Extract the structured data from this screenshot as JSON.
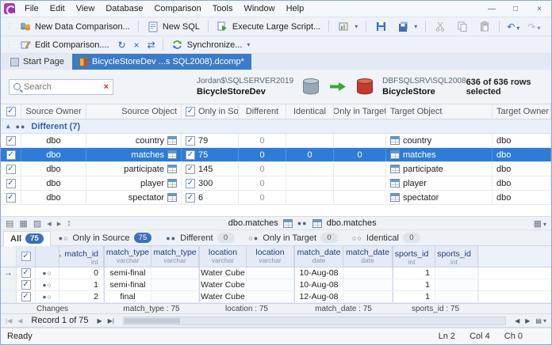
{
  "titlebar": {
    "menus": [
      "File",
      "Edit",
      "View",
      "Database",
      "Comparison",
      "Tools",
      "Window",
      "Help"
    ]
  },
  "toolbar_main": {
    "new_data_comparison": "New Data Comparison...",
    "new_sql": "New SQL",
    "execute_large_script": "Execute Large Script..."
  },
  "toolbar_compare": {
    "edit_comparison": "Edit Comparison....",
    "synchronize": "Synchronize..."
  },
  "doc_tabs": [
    {
      "label": "Start Page"
    },
    {
      "label": "BicycleStoreDev ...s SQL2008).dcomp*"
    }
  ],
  "comparison_header": {
    "search": {
      "placeholder": "Search"
    },
    "source": {
      "server": "Jordan$\\SQLSERVER2019",
      "database": "BicycleStoreDev"
    },
    "target": {
      "server": "DBFSQLSRV\\SQL2008",
      "database": "BicycleStore"
    },
    "selection_summary": "636 of 636 rows selected"
  },
  "upper_grid": {
    "headers": {
      "source_owner": "Source Owner",
      "source_object": "Source Object",
      "only_in_source": "Only in Source",
      "different": "Different",
      "identical": "Identical",
      "only_in_target": "Only in Target",
      "target_object": "Target Object",
      "target_owner": "Target Owner"
    },
    "group": {
      "glyph": "●●",
      "label": "Different (7)"
    },
    "rows": [
      {
        "source_owner": "dbo",
        "source_object": "country",
        "only_in_source": "79",
        "different": "0",
        "identical": "",
        "only_in_target": "",
        "target_object": "country",
        "target_owner": "dbo"
      },
      {
        "source_owner": "dbo",
        "source_object": "matches",
        "only_in_source": "75",
        "different": "0",
        "identical": "0",
        "only_in_target": "0",
        "target_object": "matches",
        "target_owner": "dbo"
      },
      {
        "source_owner": "dbo",
        "source_object": "participate",
        "only_in_source": "145",
        "different": "0",
        "identical": "",
        "only_in_target": "",
        "target_object": "participate",
        "target_owner": "dbo"
      },
      {
        "source_owner": "dbo",
        "source_object": "player",
        "only_in_source": "300",
        "different": "0",
        "identical": "",
        "only_in_target": "",
        "target_object": "player",
        "target_owner": "dbo"
      },
      {
        "source_owner": "dbo",
        "source_object": "spectator",
        "only_in_source": "6",
        "different": "0",
        "identical": "",
        "only_in_target": "",
        "target_object": "spectator",
        "target_owner": "dbo"
      }
    ]
  },
  "detail": {
    "mapping": {
      "source": "dbo.matches",
      "glyph": "●●",
      "target": "dbo.matches"
    },
    "tabs": [
      {
        "glyph": "",
        "label": "All",
        "badge": "75"
      },
      {
        "glyph": "●○",
        "label": "Only in Source",
        "badge": "75"
      },
      {
        "glyph": "●●",
        "label": "Different",
        "badge": "0"
      },
      {
        "glyph": "○●",
        "label": "Only in Target",
        "badge": "0"
      },
      {
        "glyph": "○○",
        "label": "Identical",
        "badge": "0"
      }
    ],
    "grid": {
      "columns": [
        {
          "name": "match_id",
          "type": "int"
        },
        {
          "name": "match_type",
          "type": "varchar"
        },
        {
          "name": "match_type",
          "type": "varchar"
        },
        {
          "name": "location",
          "type": "varchar"
        },
        {
          "name": "location",
          "type": "varchar"
        },
        {
          "name": "match_date",
          "type": "date"
        },
        {
          "name": "match_date",
          "type": "date"
        },
        {
          "name": "sports_id",
          "type": "int"
        },
        {
          "name": "sports_id",
          "type": "int"
        }
      ],
      "rows": [
        {
          "glyph": "●○",
          "match_id": "0",
          "match_type_src": "semi-final",
          "match_type_tgt": "",
          "location_src": "Water Cube",
          "location_tgt": "",
          "match_date_src": "10-Aug-08",
          "match_date_tgt": "",
          "sports_id_src": "1",
          "sports_id_tgt": ""
        },
        {
          "glyph": "●○",
          "match_id": "1",
          "match_type_src": "semi-final",
          "match_type_tgt": "",
          "location_src": "Water Cube",
          "location_tgt": "",
          "match_date_src": "10-Aug-08",
          "match_date_tgt": "",
          "sports_id_src": "1",
          "sports_id_tgt": ""
        },
        {
          "glyph": "●○",
          "match_id": "2",
          "match_type_src": "final",
          "match_type_tgt": "",
          "location_src": "Water Cube",
          "location_tgt": "",
          "match_date_src": "12-Aug-08",
          "match_date_tgt": "",
          "sports_id_src": "1",
          "sports_id_tgt": ""
        }
      ],
      "changes": {
        "label": "Changes",
        "items": [
          "match_type : 75",
          "location : 75",
          "match_date : 75",
          "sports_id : 75"
        ]
      }
    },
    "record_navigator": {
      "text": "Record 1 of 75"
    }
  },
  "status_bar": {
    "state": "Ready",
    "line": "Ln 2",
    "column": "Col 4",
    "character": "Ch 0"
  }
}
